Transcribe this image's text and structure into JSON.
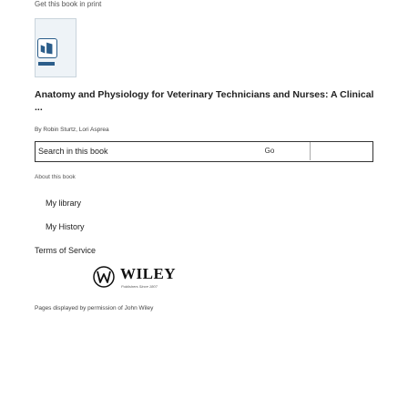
{
  "header": {
    "top_link": "Get this book in print"
  },
  "book": {
    "title": "Anatomy and Physiology for Veterinary Technicians and Nurses: A Clinical ...",
    "authors": "By Robin Sturtz, Lori Asprea"
  },
  "search": {
    "placeholder": "Search in this book",
    "go_label": "Go"
  },
  "links": {
    "about": "About this book",
    "my_library": "My library",
    "my_history": "My History",
    "terms": "Terms of Service"
  },
  "publisher": {
    "logo_text": "WILEY",
    "logo_sub": "Publishers Since 1807",
    "permission": "Pages displayed by permission of John Wiley"
  },
  "icons": {
    "cover_logo": "book-cover-icon",
    "wiley_logo": "wiley-logo-icon"
  }
}
